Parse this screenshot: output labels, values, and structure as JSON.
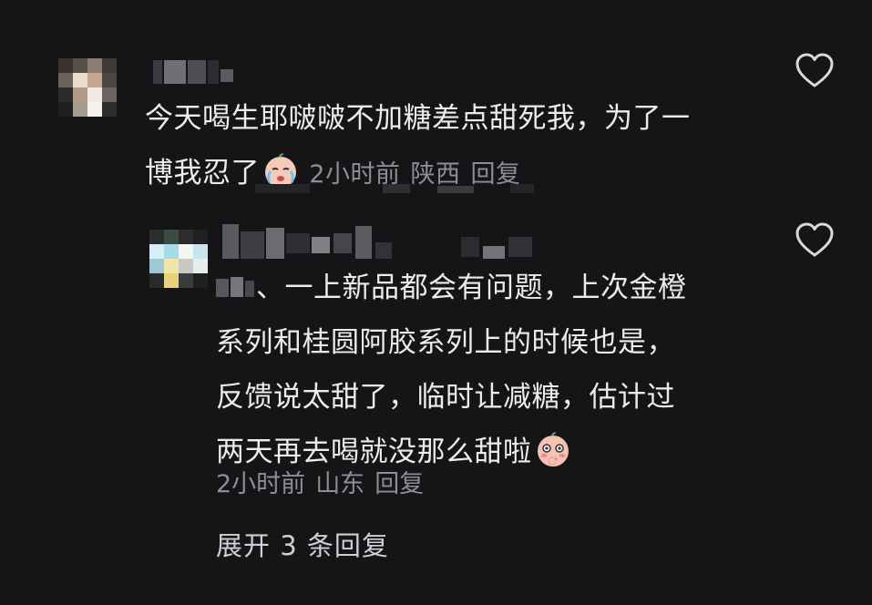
{
  "comment1": {
    "text_line1": "今天喝生耶啵啵不加糖差点甜死我，为了一",
    "text_line2": "博我忍了",
    "emoji": "crying-face-emoji",
    "time": "2小时前",
    "location": "陕西",
    "reply": "回复"
  },
  "comment2": {
    "text_line1": "、一上新品都会有问题，上次金橙",
    "text_line2": "系列和桂圆阿胶系列上的时候也是，",
    "text_line3": "反馈说太甜了，临时让减糖，估计过",
    "text_line4": "两天再去喝就没那么甜啦",
    "emoji": "blushing-face-emoji",
    "time": "2小时前",
    "location": "山东",
    "reply": "回复"
  },
  "expand_label": "展开 3 条回复",
  "colors": {
    "background": "#151518",
    "text": "#ececec",
    "meta": "#8d8d93"
  }
}
